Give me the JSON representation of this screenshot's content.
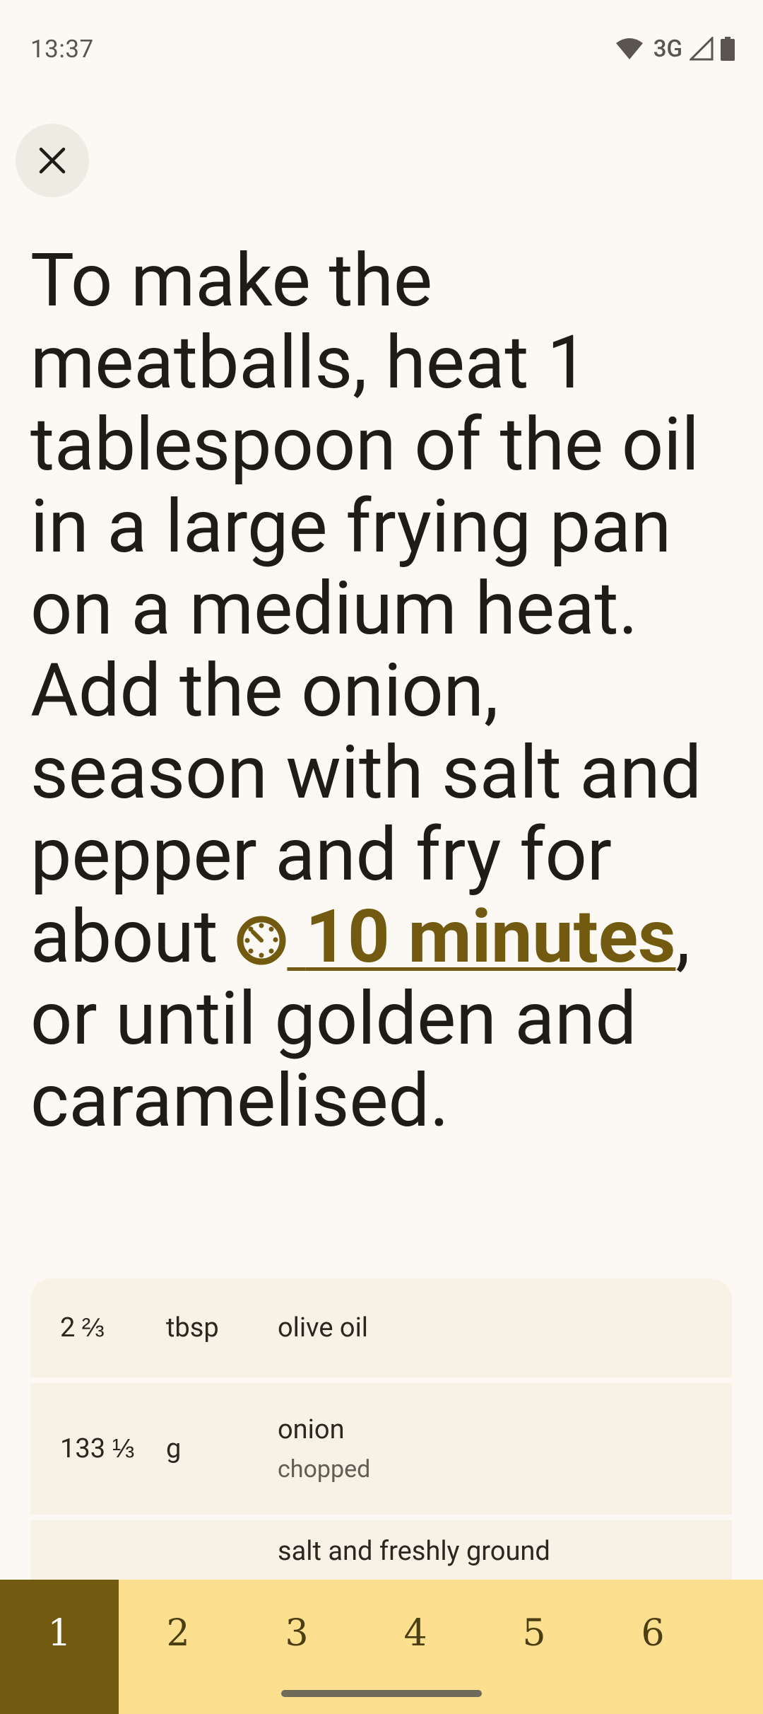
{
  "status": {
    "time": "13:37",
    "network": "3G"
  },
  "instruction": {
    "before": "To make the meatballs, heat 1 tablespoon of the oil in a large frying pan on a medium heat. Add the onion, season with salt and pepper and fry for about ",
    "timer": "10 minutes",
    "after": ", or until golden and caramelised."
  },
  "ingredients": [
    {
      "qty": "2 ⅔",
      "unit": "tbsp",
      "name": "olive oil",
      "note": ""
    },
    {
      "qty": "133 ⅓",
      "unit": "g",
      "name": "onion",
      "note": "chopped"
    },
    {
      "qty": "",
      "unit": "",
      "name": "salt and freshly ground",
      "note": ""
    }
  ],
  "steps": [
    "1",
    "2",
    "3",
    "4",
    "5",
    "6"
  ],
  "colors": {
    "accent": "#725b10",
    "nav_bg": "#fde08f",
    "background": "#fcf8f3"
  }
}
